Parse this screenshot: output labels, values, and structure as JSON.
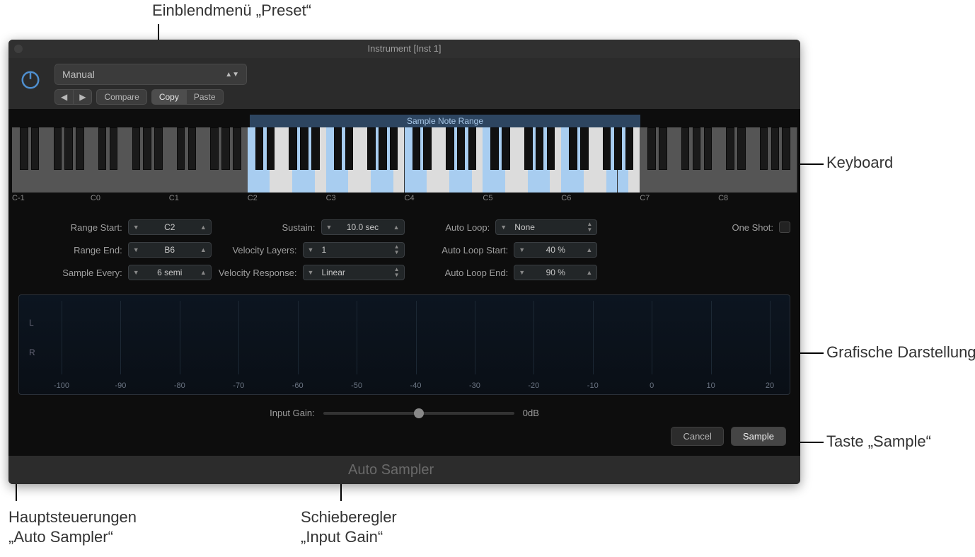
{
  "titlebar": {
    "title": "Instrument [Inst 1]"
  },
  "header": {
    "preset": "Manual",
    "compare": "Compare",
    "copy": "Copy",
    "paste": "Paste"
  },
  "keyboard": {
    "range_label": "Sample Note Range",
    "octaves": [
      "C-1",
      "C0",
      "C1",
      "C2",
      "C3",
      "C4",
      "C5",
      "C6",
      "C7",
      "C8"
    ],
    "range_start_white_index": 21,
    "range_end_white_index": 55,
    "highlighted_white_indices": [
      21,
      22,
      25,
      26,
      28,
      29,
      32,
      33,
      35,
      36,
      39,
      40,
      42,
      43,
      46,
      47,
      49,
      50,
      53,
      54
    ]
  },
  "params": {
    "range_start": {
      "label": "Range Start:",
      "value": "C2"
    },
    "range_end": {
      "label": "Range End:",
      "value": "B6"
    },
    "sample_every": {
      "label": "Sample Every:",
      "value": "6 semi"
    },
    "sustain": {
      "label": "Sustain:",
      "value": "10.0 sec"
    },
    "velocity_layers": {
      "label": "Velocity Layers:",
      "value": "1",
      "type": "select"
    },
    "velocity_response": {
      "label": "Velocity Response:",
      "value": "Linear",
      "type": "select"
    },
    "auto_loop": {
      "label": "Auto Loop:",
      "value": "None",
      "type": "select"
    },
    "auto_loop_start": {
      "label": "Auto Loop Start:",
      "value": "40 %"
    },
    "auto_loop_end": {
      "label": "Auto Loop End:",
      "value": "90 %"
    },
    "one_shot": {
      "label": "One Shot:"
    }
  },
  "graph": {
    "channels": [
      "L",
      "R"
    ],
    "xticks": [
      "-100",
      "-90",
      "-80",
      "-70",
      "-60",
      "-50",
      "-40",
      "-30",
      "-20",
      "-10",
      "0",
      "10",
      "20"
    ]
  },
  "gain": {
    "label": "Input Gain:",
    "value": "0dB"
  },
  "actions": {
    "cancel": "Cancel",
    "sample": "Sample"
  },
  "footer": {
    "name": "Auto Sampler"
  },
  "annotations": {
    "preset": "Einblendmenü „Preset“",
    "keyboard": "Keyboard",
    "graph": "Grafische Darstellung",
    "sample_btn": "Taste „Sample“",
    "main_controls_l1": "Hauptsteuerungen",
    "main_controls_l2": "„Auto Sampler“",
    "gain_l1": "Schieberegler",
    "gain_l2": "„Input Gain“"
  }
}
